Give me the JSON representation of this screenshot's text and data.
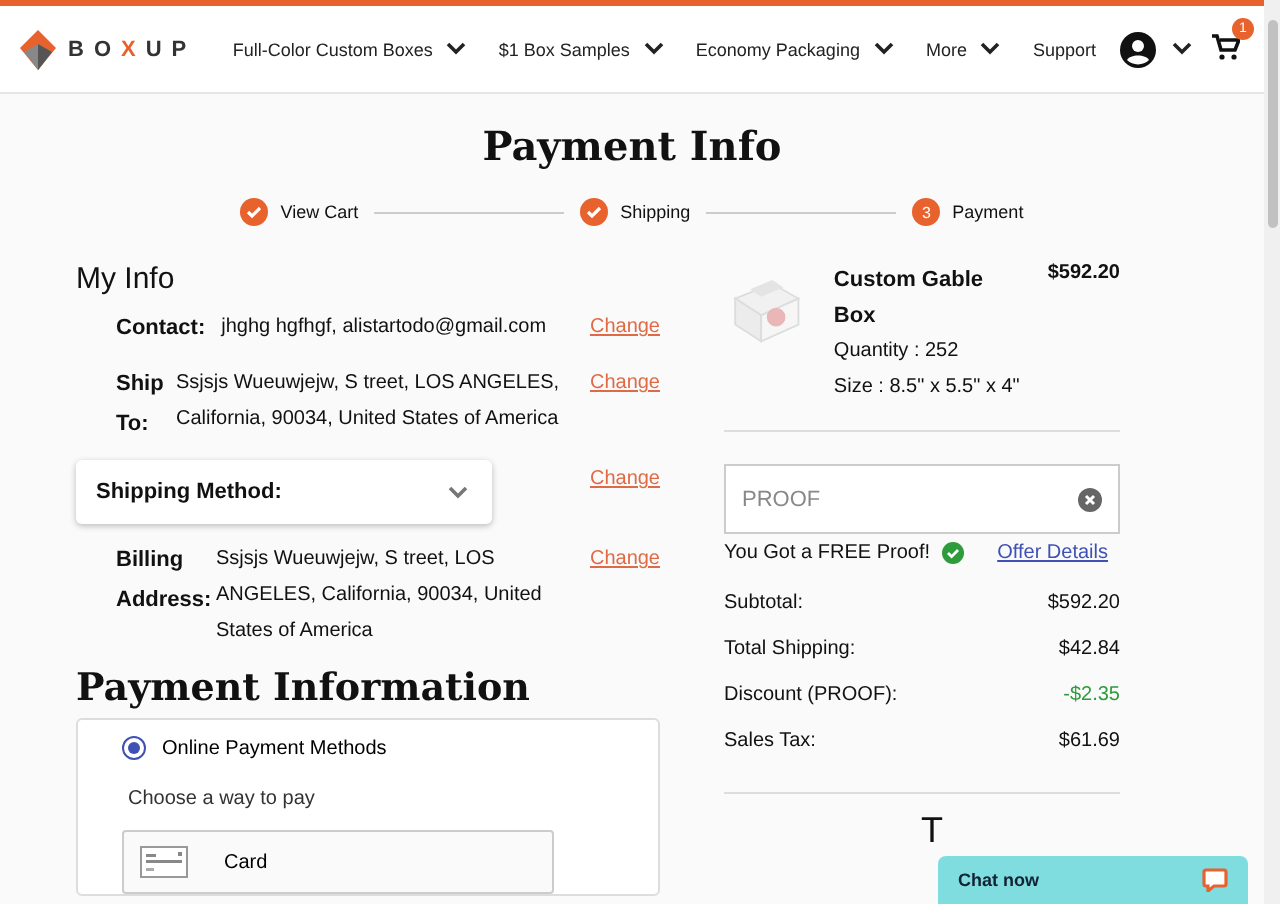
{
  "header": {
    "logo": [
      {
        "text": "BO",
        "accent": false
      },
      {
        "text": "X",
        "accent": true
      },
      {
        "text": "UP",
        "accent": false
      }
    ],
    "nav": [
      {
        "label": "Full-Color Custom Boxes",
        "dropdown": true
      },
      {
        "label": "$1 Box Samples",
        "dropdown": true
      },
      {
        "label": "Economy Packaging",
        "dropdown": true
      },
      {
        "label": "More",
        "dropdown": true
      },
      {
        "label": "Support",
        "dropdown": false
      }
    ],
    "cart_count": "1"
  },
  "title": "Payment Info",
  "steps": [
    {
      "label": "View Cart",
      "done": true
    },
    {
      "label": "Shipping",
      "done": true
    },
    {
      "label": "Payment",
      "done": false,
      "number": "3"
    }
  ],
  "my_info": {
    "heading": "My Info",
    "rows": [
      {
        "kind": "text",
        "label": "Contact:",
        "value": "jhghg hgfhgf, alistartodo@gmail.com",
        "action": "Change"
      },
      {
        "kind": "text",
        "label": "Ship To:",
        "value": "Ssjsjs Wueuwjejw, S treet, LOS ANGELES, California, 90034, United States of America",
        "action": "Change"
      },
      {
        "kind": "accordion",
        "label": "Shipping Method:",
        "expanded": false,
        "action": "Change"
      },
      {
        "kind": "text",
        "label": "Billing Address:",
        "value": "Ssjsjs Wueuwjejw, S treet, LOS ANGELES, California, 90034, United States of America",
        "action": "Change"
      }
    ]
  },
  "payment": {
    "heading": "Payment Information",
    "methods": [
      {
        "label": "Online Payment Methods",
        "selected": true
      }
    ],
    "prompt": "Choose a way to pay",
    "options": [
      {
        "label": "Card"
      }
    ]
  },
  "order": {
    "product": {
      "name": "Custom Gable Box",
      "price": "$592.20",
      "quantity": "Quantity : 252",
      "size": "Size : 8.5\" x 5.5\" x 4\""
    },
    "promo": {
      "placeholder": "PROOF"
    },
    "promo_message": "You Got a FREE Proof!",
    "offer_link": "Offer Details",
    "summary": [
      {
        "kind": "normal",
        "label": "Subtotal:",
        "value": "$592.20"
      },
      {
        "kind": "normal",
        "label": "Total Shipping:",
        "value": "$42.84"
      },
      {
        "kind": "discount",
        "label": "Discount (PROOF):",
        "value": "-$2.35"
      },
      {
        "kind": "normal",
        "label": "Sales Tax:",
        "value": "$61.69"
      }
    ],
    "total_label": "T"
  },
  "chat": {
    "label": "Chat now"
  }
}
